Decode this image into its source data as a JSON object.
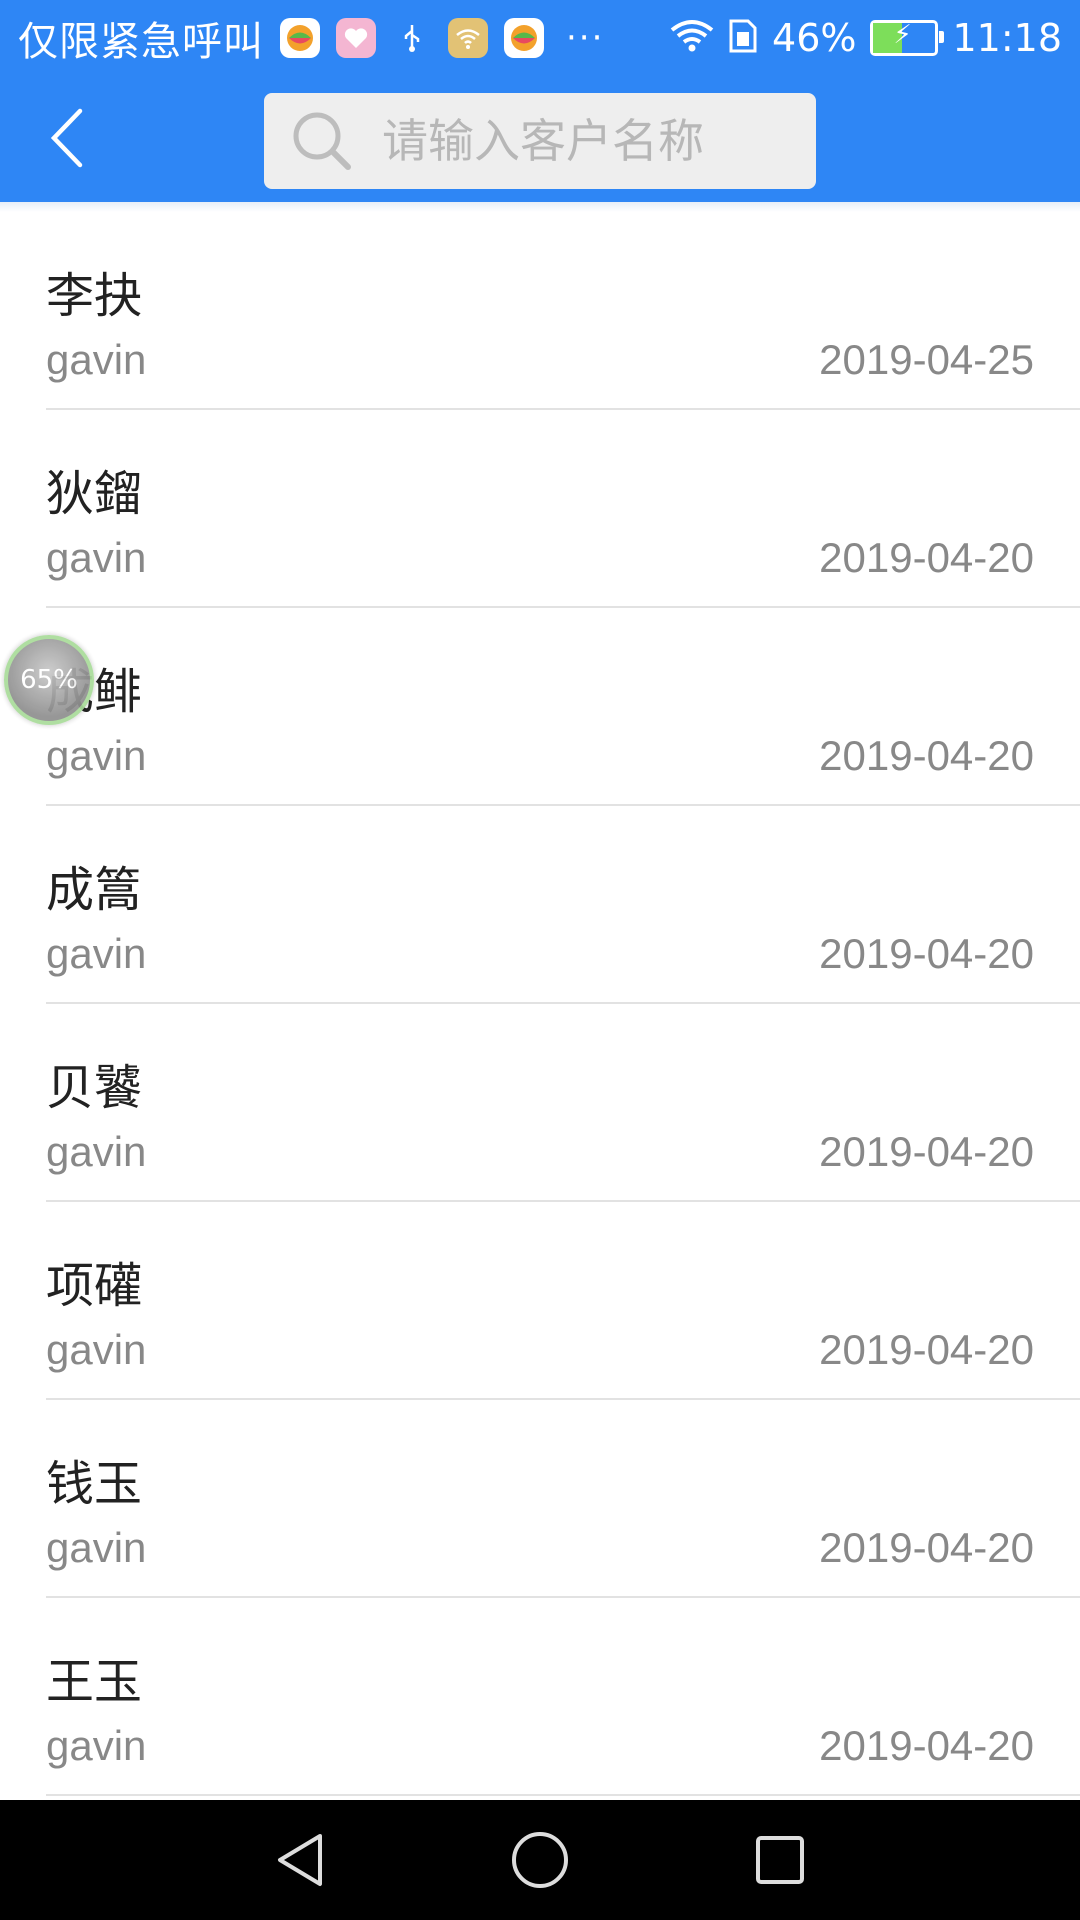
{
  "status_bar": {
    "carrier": "仅限紧急呼叫",
    "notification_icons": [
      {
        "name": "app-ball-icon",
        "color": "#f0a020"
      },
      {
        "name": "heart-icon",
        "color": "#f5a0c8"
      },
      {
        "name": "usb-icon",
        "color": "#1e90e8"
      },
      {
        "name": "wifi-hotspot-icon",
        "color": "#e0b040"
      },
      {
        "name": "app-ball-icon",
        "color": "#f0a020"
      }
    ],
    "more": "···",
    "battery_percent": "46%",
    "battery_level": 0.46,
    "time": "11:18"
  },
  "header": {
    "search_placeholder": "请输入客户名称"
  },
  "customers": [
    {
      "name": "李抉",
      "owner": "gavin",
      "date": "2019-04-25"
    },
    {
      "name": "狄鎦",
      "owner": "gavin",
      "date": "2019-04-20"
    },
    {
      "name": "成鲱",
      "owner": "gavin",
      "date": "2019-04-20"
    },
    {
      "name": "成篙",
      "owner": "gavin",
      "date": "2019-04-20"
    },
    {
      "name": "贝饕",
      "owner": "gavin",
      "date": "2019-04-20"
    },
    {
      "name": "项礶",
      "owner": "gavin",
      "date": "2019-04-20"
    },
    {
      "name": "钱玉",
      "owner": "gavin",
      "date": "2019-04-20"
    },
    {
      "name": "王玉",
      "owner": "gavin",
      "date": "2019-04-20"
    }
  ],
  "floating_ball": {
    "label": "65%"
  },
  "colors": {
    "accent": "#2e86f5",
    "nav_bar": "#000000"
  }
}
